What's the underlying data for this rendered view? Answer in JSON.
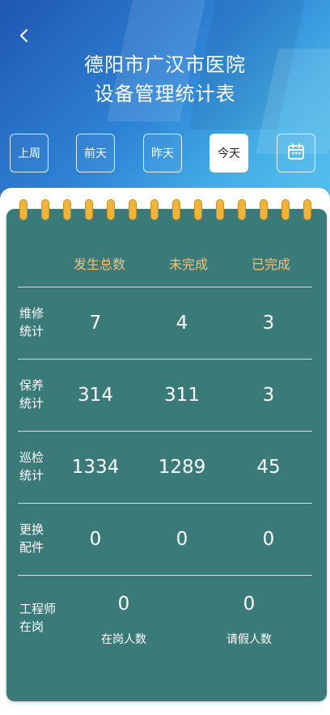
{
  "header": {
    "title_line1": "德阳市广汉市医院",
    "title_line2": "设备管理统计表"
  },
  "filters": [
    {
      "label": "上周"
    },
    {
      "label": "前天"
    },
    {
      "label": "昨天"
    },
    {
      "label": "今天",
      "active": true
    }
  ],
  "table": {
    "columns": [
      "发生总数",
      "未完成",
      "已完成"
    ],
    "rows": [
      {
        "label1": "维修",
        "label2": "统计",
        "values": [
          "7",
          "4",
          "3"
        ]
      },
      {
        "label1": "保养",
        "label2": "统计",
        "values": [
          "314",
          "311",
          "3"
        ]
      },
      {
        "label1": "巡检",
        "label2": "统计",
        "values": [
          "1334",
          "1289",
          "45"
        ]
      },
      {
        "label1": "更换",
        "label2": "配件",
        "values": [
          "0",
          "0",
          "0"
        ]
      }
    ],
    "staff": {
      "label1": "工程师",
      "label2": "在岗",
      "on_duty_value": "0",
      "on_duty_label": "在岗人数",
      "leave_value": "0",
      "leave_label": "请假人数"
    }
  },
  "colors": {
    "card": "#3a7b79",
    "header_text": "#f2c27a",
    "ring": "#f0b43a"
  }
}
